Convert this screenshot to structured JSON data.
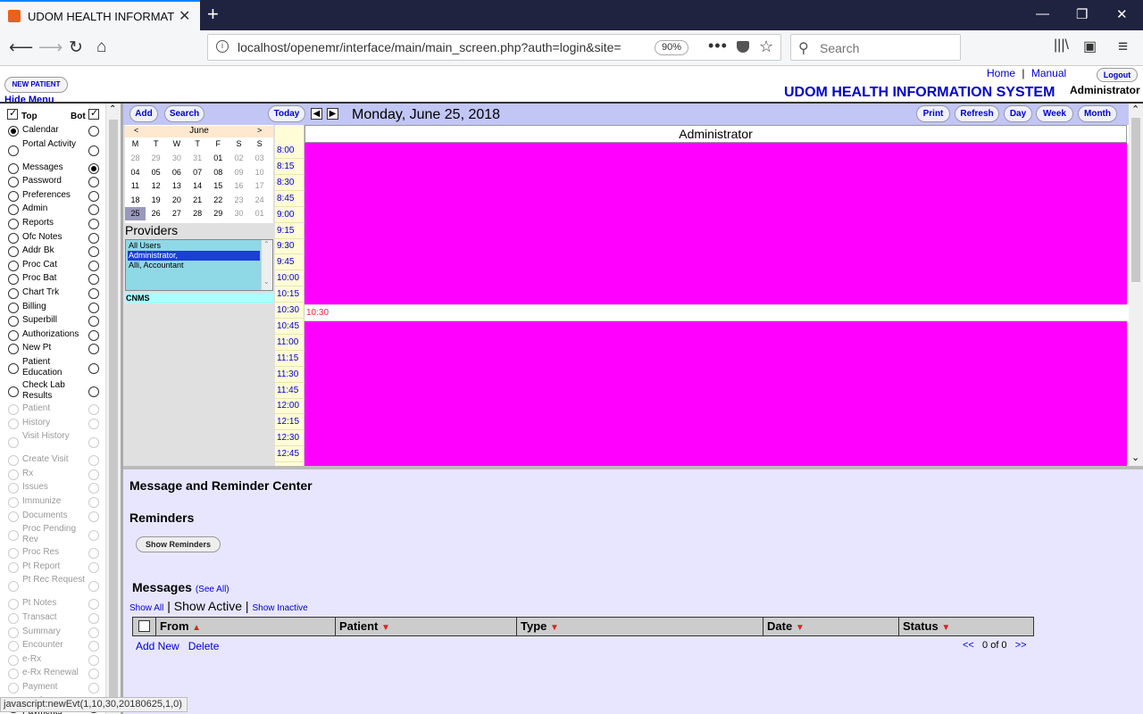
{
  "browser": {
    "tab_title": "UDOM HEALTH INFORMATION",
    "url": "localhost/openemr/interface/main/main_screen.php?auth=login&site=",
    "zoom": "90%",
    "search_placeholder": "Search"
  },
  "header": {
    "new_patient": "NEW PATIENT",
    "hide_menu": "Hide Menu",
    "home": "Home",
    "separator": "|",
    "manual": "Manual",
    "logout": "Logout",
    "app_name": "UDOM HEALTH INFORMATION SYSTEM",
    "user": "Administrator"
  },
  "nav": {
    "top_label": "Top",
    "bot_label": "Bot",
    "items": [
      {
        "label": "Calendar",
        "top": true,
        "bot": false,
        "enabled": true
      },
      {
        "label": "Portal Activity",
        "top": false,
        "bot": false,
        "enabled": true
      },
      {
        "label": "Messages",
        "top": false,
        "bot": true,
        "enabled": true
      },
      {
        "label": "Password",
        "top": false,
        "bot": false,
        "enabled": true
      },
      {
        "label": "Preferences",
        "top": false,
        "bot": false,
        "enabled": true
      },
      {
        "label": "Admin",
        "top": false,
        "bot": false,
        "enabled": true
      },
      {
        "label": "Reports",
        "top": false,
        "bot": false,
        "enabled": true
      },
      {
        "label": "Ofc Notes",
        "top": false,
        "bot": false,
        "enabled": true
      },
      {
        "label": "Addr Bk",
        "top": false,
        "bot": false,
        "enabled": true
      },
      {
        "label": "Proc Cat",
        "top": false,
        "bot": false,
        "enabled": true
      },
      {
        "label": "Proc Bat",
        "top": false,
        "bot": false,
        "enabled": true
      },
      {
        "label": "Chart Trk",
        "top": false,
        "bot": false,
        "enabled": true
      },
      {
        "label": "Billing",
        "top": false,
        "bot": false,
        "enabled": true
      },
      {
        "label": "Superbill",
        "top": false,
        "bot": false,
        "enabled": true
      },
      {
        "label": "Authorizations",
        "top": false,
        "bot": false,
        "enabled": true
      },
      {
        "label": "New Pt",
        "top": false,
        "bot": false,
        "enabled": true
      },
      {
        "label": "Patient Education",
        "top": false,
        "bot": false,
        "enabled": true
      },
      {
        "label": "Check Lab Results",
        "top": false,
        "bot": false,
        "enabled": true
      },
      {
        "label": "Patient",
        "top": false,
        "bot": false,
        "enabled": false
      },
      {
        "label": "History",
        "top": false,
        "bot": false,
        "enabled": false
      },
      {
        "label": "Visit History",
        "top": false,
        "bot": false,
        "enabled": false
      },
      {
        "label": "Create Visit",
        "top": false,
        "bot": false,
        "enabled": false
      },
      {
        "label": "Rx",
        "top": false,
        "bot": false,
        "enabled": false
      },
      {
        "label": "Issues",
        "top": false,
        "bot": false,
        "enabled": false
      },
      {
        "label": "Immunize",
        "top": false,
        "bot": false,
        "enabled": false
      },
      {
        "label": "Documents",
        "top": false,
        "bot": false,
        "enabled": false
      },
      {
        "label": "Proc Pending Rev",
        "top": false,
        "bot": false,
        "enabled": false
      },
      {
        "label": "Proc Res",
        "top": false,
        "bot": false,
        "enabled": false
      },
      {
        "label": "Pt Report",
        "top": false,
        "bot": false,
        "enabled": false
      },
      {
        "label": "Pt Rec Request",
        "top": false,
        "bot": false,
        "enabled": false
      },
      {
        "label": "Pt Notes",
        "top": false,
        "bot": false,
        "enabled": false
      },
      {
        "label": "Transact",
        "top": false,
        "bot": false,
        "enabled": false
      },
      {
        "label": "Summary",
        "top": false,
        "bot": false,
        "enabled": false
      },
      {
        "label": "Encounter",
        "top": false,
        "bot": false,
        "enabled": false
      },
      {
        "label": "e-Rx",
        "top": false,
        "bot": false,
        "enabled": false
      },
      {
        "label": "e-Rx Renewal",
        "top": false,
        "bot": false,
        "enabled": false
      },
      {
        "label": "Payment",
        "top": false,
        "bot": false,
        "enabled": false
      },
      {
        "label": "Batch Payments",
        "top": false,
        "bot": false,
        "enabled": true
      }
    ]
  },
  "calendar": {
    "add": "Add",
    "search": "Search",
    "today": "Today",
    "date_title": "Monday, June 25, 2018",
    "print": "Print",
    "refresh": "Refresh",
    "day": "Day",
    "week": "Week",
    "month": "Month",
    "mini": {
      "prev": "<",
      "month": "June",
      "next": ">",
      "weekdays": [
        "M",
        "T",
        "W",
        "T",
        "F",
        "S",
        "S"
      ],
      "weeks": [
        [
          "28",
          "29",
          "30",
          "31",
          "01",
          "02",
          "03"
        ],
        [
          "04",
          "05",
          "06",
          "07",
          "08",
          "09",
          "10"
        ],
        [
          "11",
          "12",
          "13",
          "14",
          "15",
          "16",
          "17"
        ],
        [
          "18",
          "19",
          "20",
          "21",
          "22",
          "23",
          "24"
        ],
        [
          "25",
          "26",
          "27",
          "28",
          "29",
          "30",
          "01"
        ]
      ]
    },
    "providers_title": "Providers",
    "providers": [
      "All Users",
      "Administrator,",
      "Alli, Accountant"
    ],
    "selected_provider_index": 1,
    "facility": "CNMS",
    "column_header": "Administrator",
    "times": [
      "8:00",
      "8:15",
      "8:30",
      "8:45",
      "9:00",
      "9:15",
      "9:30",
      "9:45",
      "10:00",
      "10:15",
      "10:30",
      "10:45",
      "11:00",
      "11:15",
      "11:30",
      "11:45",
      "12:00",
      "12:15",
      "12:30",
      "12:45"
    ],
    "highlight_slot": "10:30",
    "event_color": "#ff00ff"
  },
  "messages": {
    "center_title": "Message and Reminder Center",
    "reminders_title": "Reminders",
    "show_reminders": "Show Reminders",
    "messages_title": "Messages",
    "see_all": "(See All)",
    "show_all": "Show All",
    "show_active": "Show Active",
    "show_inactive": "Show Inactive",
    "columns": [
      "From",
      "Patient",
      "Type",
      "Date",
      "Status"
    ],
    "add_new": "Add New",
    "delete": "Delete",
    "pager_prev": "<<",
    "pager_count": "0 of 0",
    "pager_next": ">>"
  },
  "status_bar": "javascript:newEvt(1,10,30,20180625,1,0)"
}
